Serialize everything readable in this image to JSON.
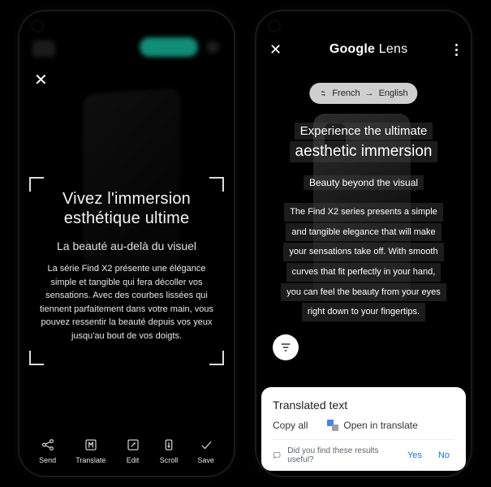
{
  "left": {
    "close_icon": "✕",
    "headline_l1": "Vivez l'immersion",
    "headline_l2": "esthétique ultime",
    "sub": "La beauté au-delà du visuel",
    "body": "La série Find X2 présente une élégance simple et tangible qui fera décoller vos sensations. Avec des courbes lissées qui tiennent parfaitement dans votre main, vous pouvez ressentir la beauté depuis vos yeux jusqu'au bout de vos doigts.",
    "tools": {
      "send": "Send",
      "translate": "Translate",
      "edit": "Edit",
      "scroll": "Scroll",
      "save": "Save"
    }
  },
  "right": {
    "close_icon": "✕",
    "brand_bold": "Google",
    "brand_light": " Lens",
    "lang_from": "French",
    "lang_to": "English",
    "line1": "Experience the ultimate",
    "line2": "aesthetic immersion",
    "line3": "Beauty beyond the visual",
    "body_l1": "The Find X2 series presents a simple",
    "body_l2": "and tangible elegance that will make",
    "body_l3": "your sensations take off. With smooth",
    "body_l4": "curves that fit perfectly in your hand,",
    "body_l5": "you can feel the beauty from your eyes",
    "body_l6": "right down to your fingertips.",
    "sheet": {
      "title": "Translated text",
      "copy_all": "Copy all",
      "open_in_translate": "Open in translate",
      "prompt": "Did you find these results useful?",
      "yes": "Yes",
      "no": "No"
    }
  }
}
